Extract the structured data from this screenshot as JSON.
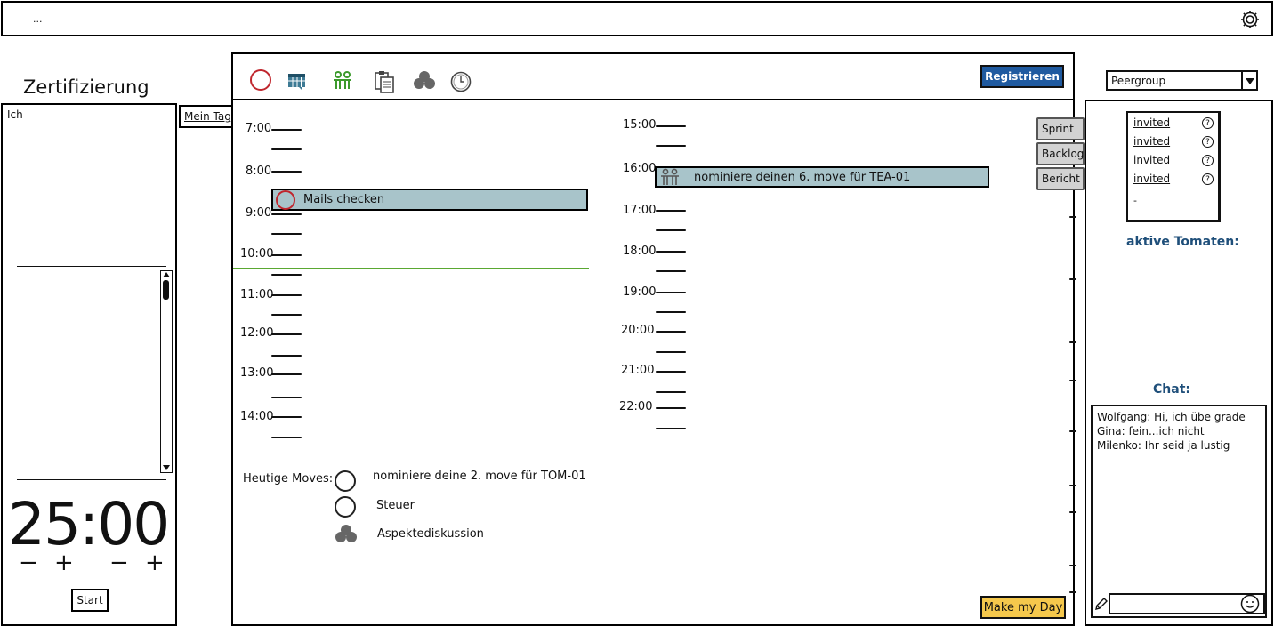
{
  "top_bar": {
    "text": "...",
    "settings_icon": "gear-icon"
  },
  "left_panel": {
    "title": "Zertifizierung",
    "user_label": "Ich",
    "timer": "25:00",
    "minus": "−",
    "plus": "+",
    "start_button": "Start"
  },
  "mein_tag_tab": "Mein Tag",
  "toolbar": {
    "icons": [
      "tomato-circle-icon",
      "calendar-icon",
      "people-icon",
      "clipboard-icon",
      "cloud-icon",
      "clock-icon"
    ],
    "register_button": "Registrieren"
  },
  "schedule": {
    "left_hours": [
      "7:00",
      "8:00",
      "9:00",
      "10:00",
      "11:00",
      "12:00",
      "13:00",
      "14:00"
    ],
    "right_hours": [
      "15:00",
      "16:00",
      "17:00",
      "18:00",
      "19:00",
      "20:00",
      "21:00",
      "22:00"
    ],
    "events": [
      {
        "label": "Mails checken"
      },
      {
        "label": "nominiere deinen 6. move für TEA-01"
      }
    ]
  },
  "moves": {
    "heading": "Heutige Moves:",
    "items": [
      {
        "label": "nominiere deine 2. move für TOM-01"
      },
      {
        "label": "Steuer"
      },
      {
        "label": "Aspektediskussion"
      }
    ]
  },
  "side_tabs": [
    "Sprint",
    "Backlog",
    "Bericht"
  ],
  "make_my_day_button": "Make my Day",
  "right_panel": {
    "peergroup_select": "Peergroup",
    "invites": [
      "invited",
      "invited",
      "invited",
      "invited"
    ],
    "invite_extra": "-",
    "active_tomatoes_title": "aktive Tomaten:",
    "chat_title": "Chat:",
    "chat_messages": [
      "Wolfgang: Hi, ich übe grade",
      "Gina: fein...ich nicht",
      "Milenko: Ihr seid ja lustig"
    ]
  },
  "colors": {
    "accent_blue": "#1f5aa0",
    "event_fill": "#a8c4ca",
    "tomato_red": "#c0262d",
    "now_line": "#5aa832",
    "make_day_yellow": "#f5c84c",
    "heading_blue": "#1f4f7a"
  }
}
